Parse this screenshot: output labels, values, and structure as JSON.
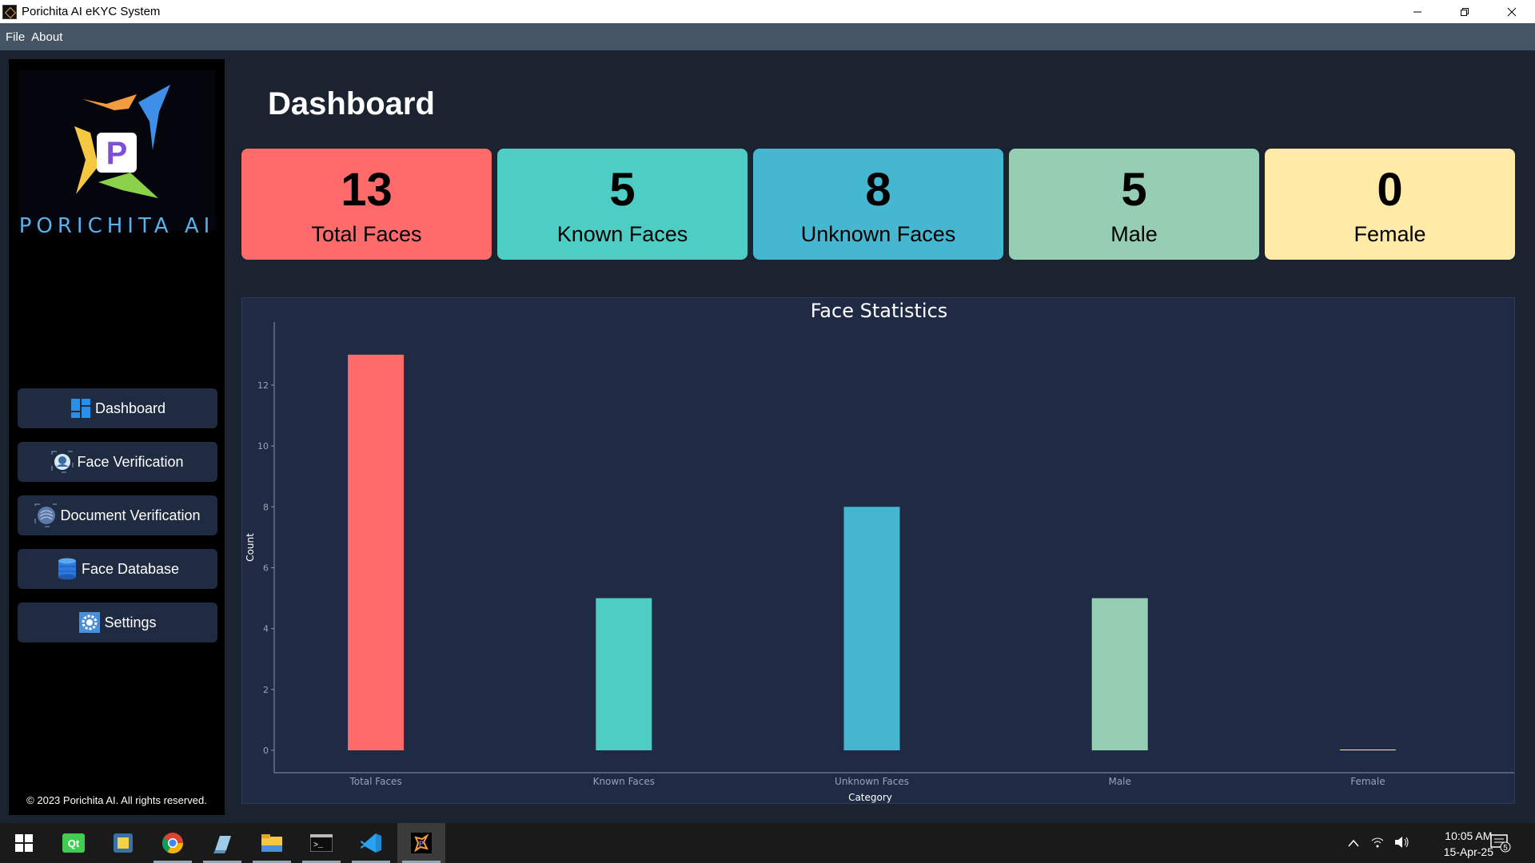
{
  "window": {
    "title": "Porichita AI eKYC System"
  },
  "menu": {
    "items": [
      "File",
      "About"
    ]
  },
  "sidebar": {
    "logo_text": "PORICHITA AI",
    "logo_letter": "P",
    "nav": [
      {
        "label": "Dashboard",
        "icon": "dashboard-icon"
      },
      {
        "label": "Face Verification",
        "icon": "face-scan-icon"
      },
      {
        "label": "Document Verification",
        "icon": "document-scan-icon"
      },
      {
        "label": "Face Database",
        "icon": "database-icon"
      },
      {
        "label": "Settings",
        "icon": "settings-gear-icon"
      }
    ],
    "footer": "© 2023 Porichita AI. All rights reserved."
  },
  "main": {
    "title": "Dashboard",
    "cards": [
      {
        "value": "13",
        "label": "Total Faces",
        "color": "#ff6b6b"
      },
      {
        "value": "5",
        "label": "Known Faces",
        "color": "#4ecdc4"
      },
      {
        "value": "8",
        "label": "Unknown Faces",
        "color": "#45b7d1"
      },
      {
        "value": "5",
        "label": "Male",
        "color": "#96ceb4"
      },
      {
        "value": "0",
        "label": "Female",
        "color": "#ffeaa7"
      }
    ]
  },
  "chart_data": {
    "type": "bar",
    "title": "Face Statistics",
    "xlabel": "Category",
    "ylabel": "Count",
    "categories": [
      "Total Faces",
      "Known Faces",
      "Unknown Faces",
      "Male",
      "Female"
    ],
    "values": [
      13,
      5,
      8,
      5,
      0
    ],
    "colors": [
      "#ff6b6b",
      "#4ecdc4",
      "#45b7d1",
      "#96ceb4",
      "#ffeaa7"
    ],
    "yticks": [
      0,
      2,
      4,
      6,
      8,
      10,
      12
    ],
    "ylim": [
      0,
      13.6
    ],
    "grid": false
  },
  "taskbar": {
    "time": "10:05 AM",
    "date": "15-Apr-25",
    "notification_count": "5",
    "apps": [
      "windows-start-icon",
      "qt-creator-icon",
      "python-idle-icon",
      "chrome-icon",
      "notes-icon",
      "file-explorer-icon",
      "terminal-icon",
      "vscode-icon",
      "porichita-app-icon"
    ]
  }
}
